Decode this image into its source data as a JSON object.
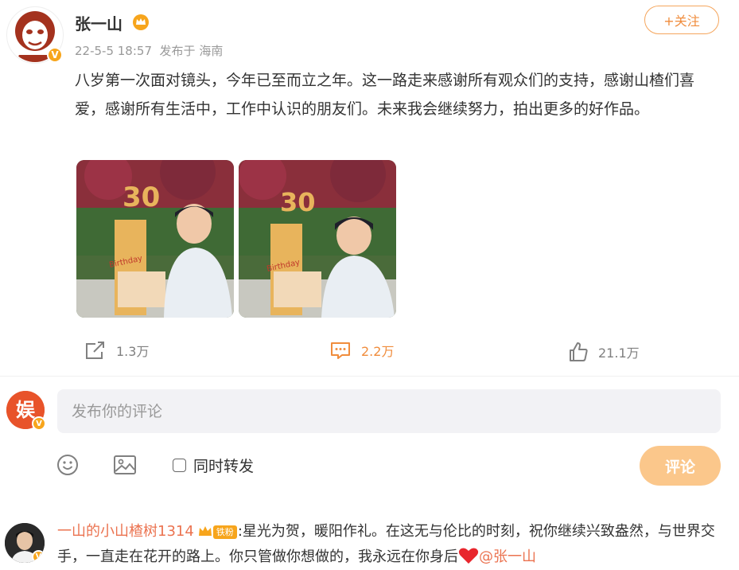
{
  "post": {
    "author": "张一山",
    "date": "22-5-5 18:57",
    "source": "发布于 海南",
    "follow_label": "+关注",
    "text": "八岁第一次面对镜头，今年已至而立之年。这一路走来感谢所有观众们的支持，感谢山楂们喜爱，感谢所有生活中，工作中认识的朋友们。未来我会继续努力，拍出更多的好作品。",
    "verified_badge": "V",
    "photos": [
      {
        "cake_number": "30",
        "cake_text": "Birthday"
      },
      {
        "cake_number": "30",
        "cake_text": "Birthday"
      }
    ],
    "actions": {
      "repost_count": "1.3万",
      "comment_count": "2.2万",
      "like_count": "21.1万"
    }
  },
  "composer": {
    "placeholder": "发布你的评论",
    "repost_label": "同时转发",
    "submit_label": "评论",
    "my_avatar_char": "娱",
    "icons": [
      "emoji-icon",
      "image-icon"
    ]
  },
  "comment": {
    "user": "一山的小山楂树1314",
    "fan_badge": "铁粉",
    "text": ":星光为贺，暖阳作礼。在这无与伦比的时刻，祝你继续兴致盎然，与世界交手，一直走在花开的路上。你只管做你想做的，我永远在你身后",
    "mention": "@张一山"
  },
  "colors": {
    "accent_orange": "#f08c3c",
    "submit_bg": "#fbc78b",
    "link_orange": "#eb7350",
    "badge_gold": "#f7a51c"
  }
}
